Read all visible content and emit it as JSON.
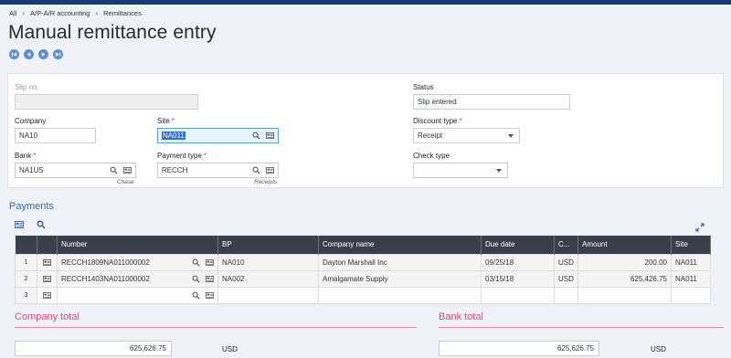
{
  "breadcrumb": [
    "All",
    "A/P-A/R accounting",
    "Remittances"
  ],
  "page_title": "Manual remittance entry",
  "form": {
    "slip_no": {
      "label": "Slip no.",
      "value": ""
    },
    "status": {
      "label": "Status",
      "value": "Slip entered"
    },
    "company": {
      "label": "Company",
      "value": "NA10"
    },
    "site": {
      "label": "Site",
      "required": "*",
      "value": "NA011"
    },
    "discount_type": {
      "label": "Discount type",
      "required": "*",
      "value": "Receipt"
    },
    "bank": {
      "label": "Bank",
      "required": "*",
      "value": "NA1US",
      "note": "Chase"
    },
    "payment_type": {
      "label": "Payment type",
      "required": "*",
      "value": "RECCH",
      "note": "Receipts"
    },
    "check_type": {
      "label": "Check type",
      "value": ""
    }
  },
  "payments": {
    "title": "Payments",
    "columns": [
      "Number",
      "BP",
      "Company name",
      "Due date",
      "C...",
      "Amount",
      "Site"
    ],
    "rows": [
      {
        "idx": "1",
        "number": "RECCH1809NA011000002",
        "bp": "NA010",
        "company_name": "Dayton Marshall Inc",
        "due_date": "09/25/18",
        "currency": "USD",
        "amount": "200.00",
        "site": "NA011"
      },
      {
        "idx": "2",
        "number": "RECCH1403NA011000002",
        "bp": "NA002",
        "company_name": "Amalgamate Supply",
        "due_date": "03/15/18",
        "currency": "USD",
        "amount": "625,426.75",
        "site": "NA011"
      },
      {
        "idx": "3",
        "number": "",
        "bp": "",
        "company_name": "",
        "due_date": "",
        "currency": "",
        "amount": "",
        "site": ""
      }
    ]
  },
  "company_total": {
    "label": "Company total",
    "value": "625,626.75",
    "currency": "USD"
  },
  "bank_total": {
    "label": "Bank total",
    "value": "625,626.75",
    "currency": "USD"
  },
  "colors": {
    "accent": "#3d66a8",
    "header_dark": "#3b3f4a",
    "required": "#e0472d",
    "total_title": "#d4507a",
    "topbar": "#1a3a70"
  }
}
